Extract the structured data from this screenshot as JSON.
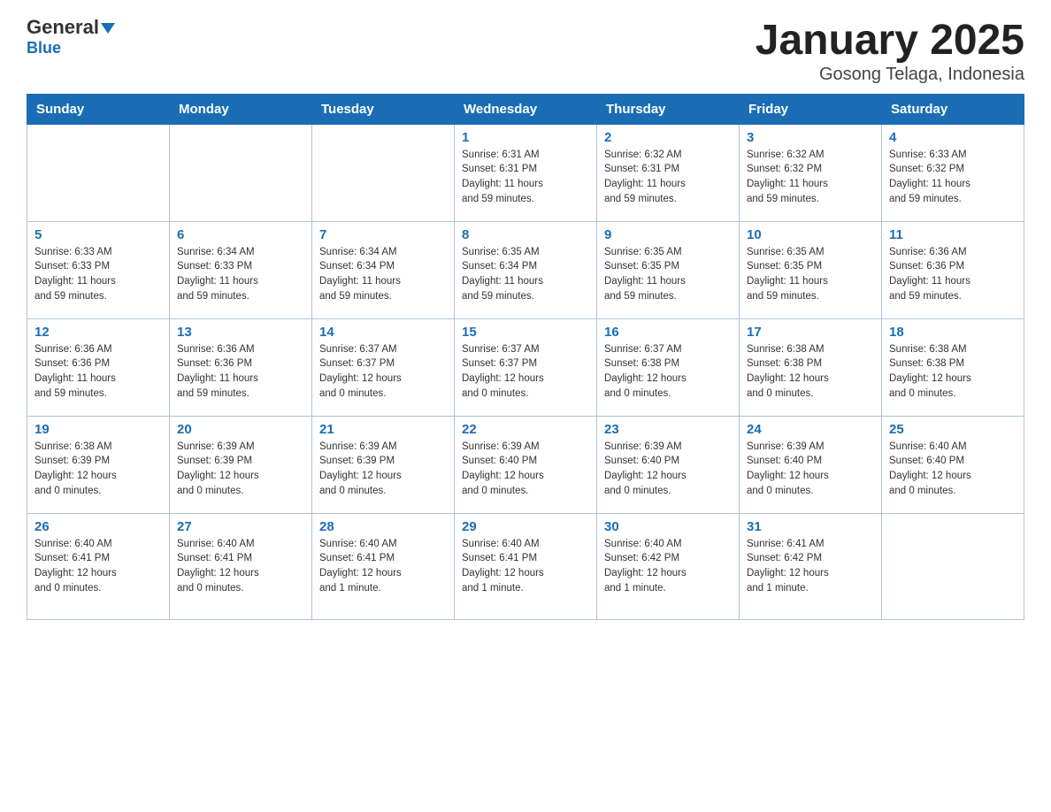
{
  "header": {
    "logo_main": "General",
    "logo_sub": "Blue",
    "title": "January 2025",
    "subtitle": "Gosong Telaga, Indonesia"
  },
  "weekdays": [
    "Sunday",
    "Monday",
    "Tuesday",
    "Wednesday",
    "Thursday",
    "Friday",
    "Saturday"
  ],
  "weeks": [
    [
      {
        "day": "",
        "info": ""
      },
      {
        "day": "",
        "info": ""
      },
      {
        "day": "",
        "info": ""
      },
      {
        "day": "1",
        "info": "Sunrise: 6:31 AM\nSunset: 6:31 PM\nDaylight: 11 hours\nand 59 minutes."
      },
      {
        "day": "2",
        "info": "Sunrise: 6:32 AM\nSunset: 6:31 PM\nDaylight: 11 hours\nand 59 minutes."
      },
      {
        "day": "3",
        "info": "Sunrise: 6:32 AM\nSunset: 6:32 PM\nDaylight: 11 hours\nand 59 minutes."
      },
      {
        "day": "4",
        "info": "Sunrise: 6:33 AM\nSunset: 6:32 PM\nDaylight: 11 hours\nand 59 minutes."
      }
    ],
    [
      {
        "day": "5",
        "info": "Sunrise: 6:33 AM\nSunset: 6:33 PM\nDaylight: 11 hours\nand 59 minutes."
      },
      {
        "day": "6",
        "info": "Sunrise: 6:34 AM\nSunset: 6:33 PM\nDaylight: 11 hours\nand 59 minutes."
      },
      {
        "day": "7",
        "info": "Sunrise: 6:34 AM\nSunset: 6:34 PM\nDaylight: 11 hours\nand 59 minutes."
      },
      {
        "day": "8",
        "info": "Sunrise: 6:35 AM\nSunset: 6:34 PM\nDaylight: 11 hours\nand 59 minutes."
      },
      {
        "day": "9",
        "info": "Sunrise: 6:35 AM\nSunset: 6:35 PM\nDaylight: 11 hours\nand 59 minutes."
      },
      {
        "day": "10",
        "info": "Sunrise: 6:35 AM\nSunset: 6:35 PM\nDaylight: 11 hours\nand 59 minutes."
      },
      {
        "day": "11",
        "info": "Sunrise: 6:36 AM\nSunset: 6:36 PM\nDaylight: 11 hours\nand 59 minutes."
      }
    ],
    [
      {
        "day": "12",
        "info": "Sunrise: 6:36 AM\nSunset: 6:36 PM\nDaylight: 11 hours\nand 59 minutes."
      },
      {
        "day": "13",
        "info": "Sunrise: 6:36 AM\nSunset: 6:36 PM\nDaylight: 11 hours\nand 59 minutes."
      },
      {
        "day": "14",
        "info": "Sunrise: 6:37 AM\nSunset: 6:37 PM\nDaylight: 12 hours\nand 0 minutes."
      },
      {
        "day": "15",
        "info": "Sunrise: 6:37 AM\nSunset: 6:37 PM\nDaylight: 12 hours\nand 0 minutes."
      },
      {
        "day": "16",
        "info": "Sunrise: 6:37 AM\nSunset: 6:38 PM\nDaylight: 12 hours\nand 0 minutes."
      },
      {
        "day": "17",
        "info": "Sunrise: 6:38 AM\nSunset: 6:38 PM\nDaylight: 12 hours\nand 0 minutes."
      },
      {
        "day": "18",
        "info": "Sunrise: 6:38 AM\nSunset: 6:38 PM\nDaylight: 12 hours\nand 0 minutes."
      }
    ],
    [
      {
        "day": "19",
        "info": "Sunrise: 6:38 AM\nSunset: 6:39 PM\nDaylight: 12 hours\nand 0 minutes."
      },
      {
        "day": "20",
        "info": "Sunrise: 6:39 AM\nSunset: 6:39 PM\nDaylight: 12 hours\nand 0 minutes."
      },
      {
        "day": "21",
        "info": "Sunrise: 6:39 AM\nSunset: 6:39 PM\nDaylight: 12 hours\nand 0 minutes."
      },
      {
        "day": "22",
        "info": "Sunrise: 6:39 AM\nSunset: 6:40 PM\nDaylight: 12 hours\nand 0 minutes."
      },
      {
        "day": "23",
        "info": "Sunrise: 6:39 AM\nSunset: 6:40 PM\nDaylight: 12 hours\nand 0 minutes."
      },
      {
        "day": "24",
        "info": "Sunrise: 6:39 AM\nSunset: 6:40 PM\nDaylight: 12 hours\nand 0 minutes."
      },
      {
        "day": "25",
        "info": "Sunrise: 6:40 AM\nSunset: 6:40 PM\nDaylight: 12 hours\nand 0 minutes."
      }
    ],
    [
      {
        "day": "26",
        "info": "Sunrise: 6:40 AM\nSunset: 6:41 PM\nDaylight: 12 hours\nand 0 minutes."
      },
      {
        "day": "27",
        "info": "Sunrise: 6:40 AM\nSunset: 6:41 PM\nDaylight: 12 hours\nand 0 minutes."
      },
      {
        "day": "28",
        "info": "Sunrise: 6:40 AM\nSunset: 6:41 PM\nDaylight: 12 hours\nand 1 minute."
      },
      {
        "day": "29",
        "info": "Sunrise: 6:40 AM\nSunset: 6:41 PM\nDaylight: 12 hours\nand 1 minute."
      },
      {
        "day": "30",
        "info": "Sunrise: 6:40 AM\nSunset: 6:42 PM\nDaylight: 12 hours\nand 1 minute."
      },
      {
        "day": "31",
        "info": "Sunrise: 6:41 AM\nSunset: 6:42 PM\nDaylight: 12 hours\nand 1 minute."
      },
      {
        "day": "",
        "info": ""
      }
    ]
  ]
}
